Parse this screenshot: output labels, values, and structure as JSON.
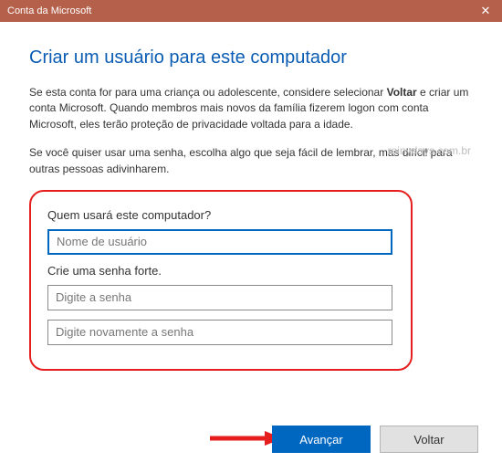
{
  "titlebar": {
    "title": "Conta da Microsoft",
    "close": "✕"
  },
  "heading": "Criar um usuário para este computador",
  "para1_pre": "Se esta conta for para uma criança ou adolescente, considere selecionar ",
  "para1_bold": "Voltar",
  "para1_post": " e criar um conta Microsoft. Quando membros mais novos da família fizerem logon com conta Microsoft, eles terão proteção de privacidade voltada para a idade.",
  "watermark": "rainydays.com.br",
  "para2": "Se você quiser usar uma senha, escolha algo que seja fácil de lembrar, mas difícil para outras pessoas adivinharem.",
  "form": {
    "q1": "Quem usará este computador?",
    "username_ph": "Nome de usuário",
    "q2": "Crie uma senha forte.",
    "password_ph": "Digite a senha",
    "confirm_ph": "Digite novamente a senha"
  },
  "buttons": {
    "next": "Avançar",
    "back": "Voltar"
  }
}
